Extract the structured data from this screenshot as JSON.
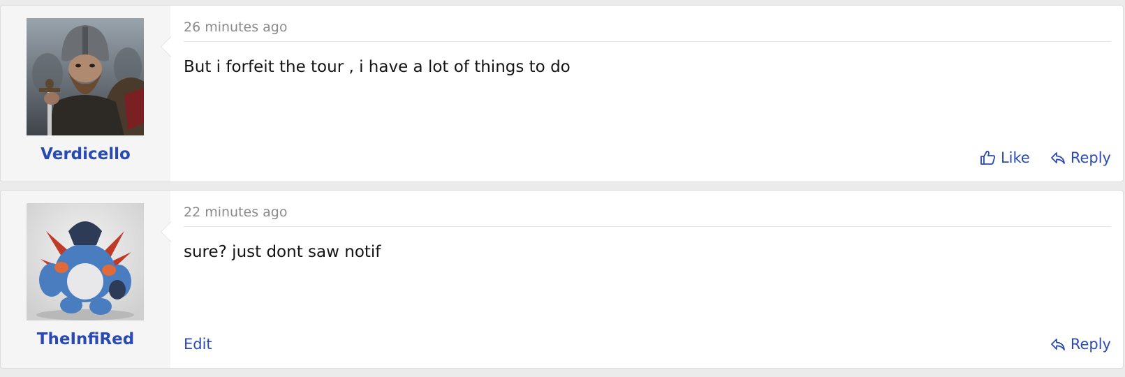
{
  "posts": [
    {
      "username": "Verdicello",
      "timestamp": "26 minutes ago",
      "message": "But i forfeit the tour , i have a lot of things to do",
      "like_label": "Like",
      "reply_label": "Reply"
    },
    {
      "username": "TheInfiRed",
      "timestamp": "22 minutes ago",
      "message": "sure? just dont saw notif",
      "edit_label": "Edit",
      "reply_label": "Reply"
    }
  ],
  "colors": {
    "link": "#2a4ab3",
    "muted": "#8a8a8a",
    "sidebar": "#f5f5f5"
  },
  "icons": {
    "like": "thumbs-up-icon",
    "reply": "reply-arrow-icon"
  }
}
